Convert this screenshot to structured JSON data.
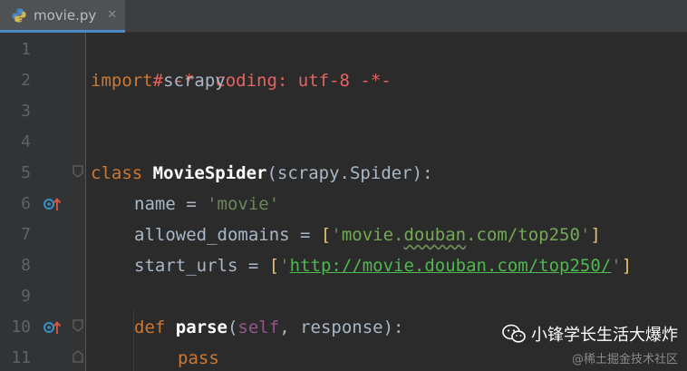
{
  "tab": {
    "filename": "movie.py",
    "close_glyph": "✕",
    "icon": "python-file-icon"
  },
  "lines": [
    {
      "number": "1"
    },
    {
      "number": "2"
    },
    {
      "number": "3"
    },
    {
      "number": "4"
    },
    {
      "number": "5"
    },
    {
      "number": "6"
    },
    {
      "number": "7"
    },
    {
      "number": "8"
    },
    {
      "number": "9"
    },
    {
      "number": "10"
    },
    {
      "number": "11"
    }
  ],
  "code": {
    "l1": "# -*- coding: utf-8 -*-",
    "l2_kw": "import",
    "l2_rest": " scrapy",
    "l5_kw": "class",
    "l5_name": " MovieSpider",
    "l5_rest": "(scrapy.Spider):",
    "l6_var": "name = ",
    "l6_str": "'movie'",
    "l7_var": "allowed_domains = ",
    "l7_open": "[",
    "l7_q1": "'",
    "l7_str_a": "movie.",
    "l7_str_b": "douban",
    "l7_str_c": ".com/top250",
    "l7_q2": "'",
    "l7_close": "]",
    "l8_var": "start_urls = ",
    "l8_open": "[",
    "l8_q1": "'",
    "l8_url": "http://movie.douban.com/top250/",
    "l8_q2": "'",
    "l8_close": "]",
    "l10_kw": "def",
    "l10_name": " parse",
    "l10_open": "(",
    "l10_self": "self",
    "l10_rest": ", response):",
    "l11_kw": "pass"
  },
  "watermark": {
    "main": "小锋学长生活大爆炸",
    "sub": "@稀土掘金技术社区",
    "icon": "wechat-icon"
  },
  "colors": {
    "background": "#2b2b2b",
    "gutter": "#313335",
    "comment": "#e8635f",
    "keyword": "#cc7832",
    "string": "#6a8759",
    "url": "#4fb84f",
    "self": "#94558d"
  }
}
